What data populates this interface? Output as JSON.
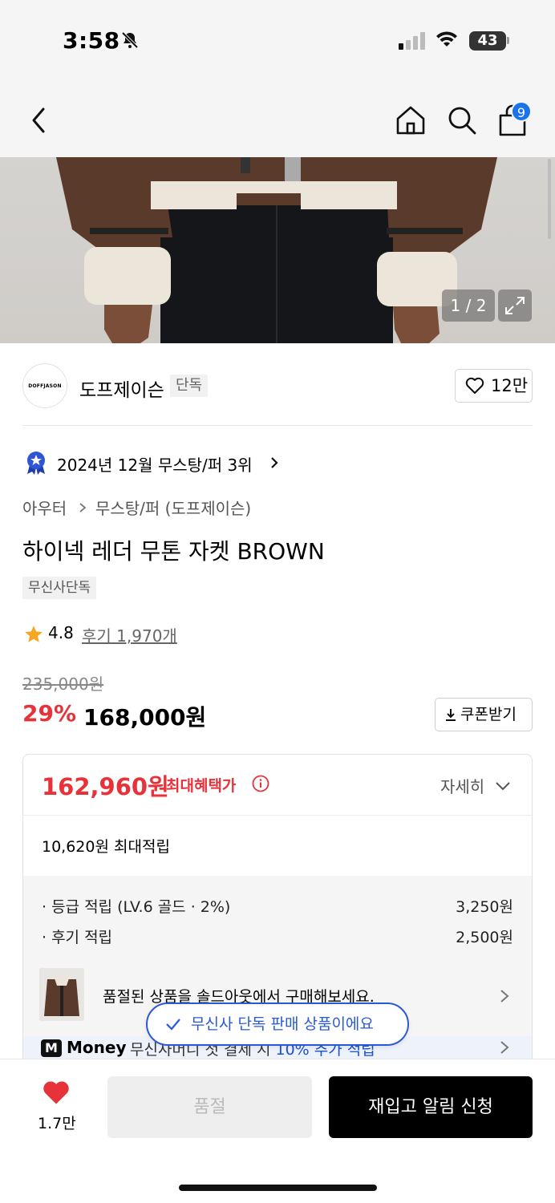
{
  "status_bar": {
    "time": "3:58",
    "battery": "43"
  },
  "nav": {
    "cart_count": "9"
  },
  "gallery": {
    "counter": "1 / 2"
  },
  "brand": {
    "logo_text": "DOFFJASON",
    "name": "도프제이슨",
    "tag": "단독",
    "likes": "12만"
  },
  "ranking": {
    "text": "2024년 12월 무스탕/퍼 3위"
  },
  "breadcrumb": {
    "level1": "아우터",
    "level2": "무스탕/퍼 (도프제이슨)"
  },
  "product": {
    "title": "하이넥 레더 무톤 자켓 BROWN",
    "exclusive_tag": "무신사단독",
    "rating": "4.8",
    "reviews": "후기 1,970개",
    "original_price": "235,000원",
    "discount": "29%",
    "price": "168,000원",
    "coupon_label": "쿠폰받기"
  },
  "benefit": {
    "max_price": "162,960원",
    "max_label": "최대혜택가",
    "detail_label": "자세히",
    "points_total": "10,620원 최대적립",
    "rows": [
      {
        "label": "· 등급 적립 (LV.6 골드 · 2%)",
        "value": "3,250원"
      },
      {
        "label": "· 후기 적립",
        "value": "2,500원"
      }
    ],
    "soldout_text": "품절된 상품을 솔드아웃에서 구매해보세요.",
    "money_badge": "M",
    "money_label": "Money",
    "money_desc": "무신사머니 첫 결제 시",
    "money_highlight": "10% 추가 적립"
  },
  "toast": {
    "text": "무신사 단독 판매 상품이에요"
  },
  "bottom": {
    "like_count": "1.7만",
    "soldout_label": "품절",
    "notify_label": "재입고 알림 신청"
  },
  "colors": {
    "accent_red": "#e8323a",
    "accent_blue": "#2a59d8",
    "badge_blue": "#1a73e8"
  }
}
